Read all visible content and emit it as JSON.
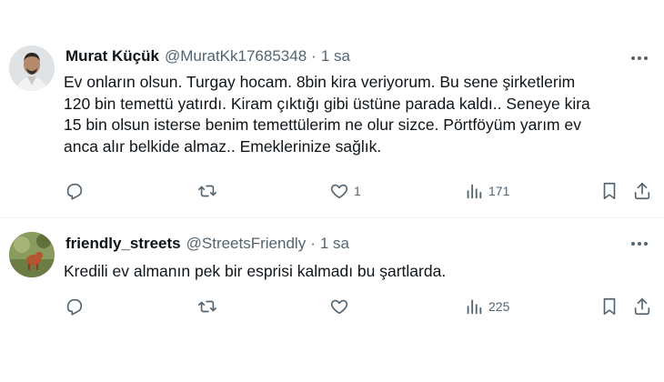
{
  "tweets": [
    {
      "author": "Murat Küçük",
      "handle": "@MuratKk17685348",
      "separator": "·",
      "time": "1 sa",
      "lines": [
        "Ev onların olsun. Turgay hocam. 8bin kira veriyorum. Bu sene şirketlerim",
        "120 bin temettü yatırdı. Kiram çıktığı gibi üstüne parada kaldı.. Seneye kira",
        "15 bin olsun isterse benim temettülerim ne olur sizce. Pörtföyüm yarım ev",
        "anca alır belkide almaz.. Emeklerinize sağlık."
      ],
      "replies": "",
      "retweets": "",
      "likes": "1",
      "views": "171"
    },
    {
      "author": "friendly_streets",
      "handle": "@StreetsFriendly",
      "separator": "·",
      "time": "1 sa",
      "lines": [
        "Kredili ev almanın pek bir esprisi kalmadı bu şartlarda."
      ],
      "replies": "",
      "retweets": "",
      "likes": "",
      "views": "225"
    }
  ],
  "colors": {
    "text": "#0f1419",
    "secondary": "#536471",
    "divider": "#eff3f4"
  },
  "icons": [
    "more-icon",
    "reply-icon",
    "retweet-icon",
    "like-icon",
    "views-icon",
    "bookmark-icon",
    "share-icon"
  ]
}
